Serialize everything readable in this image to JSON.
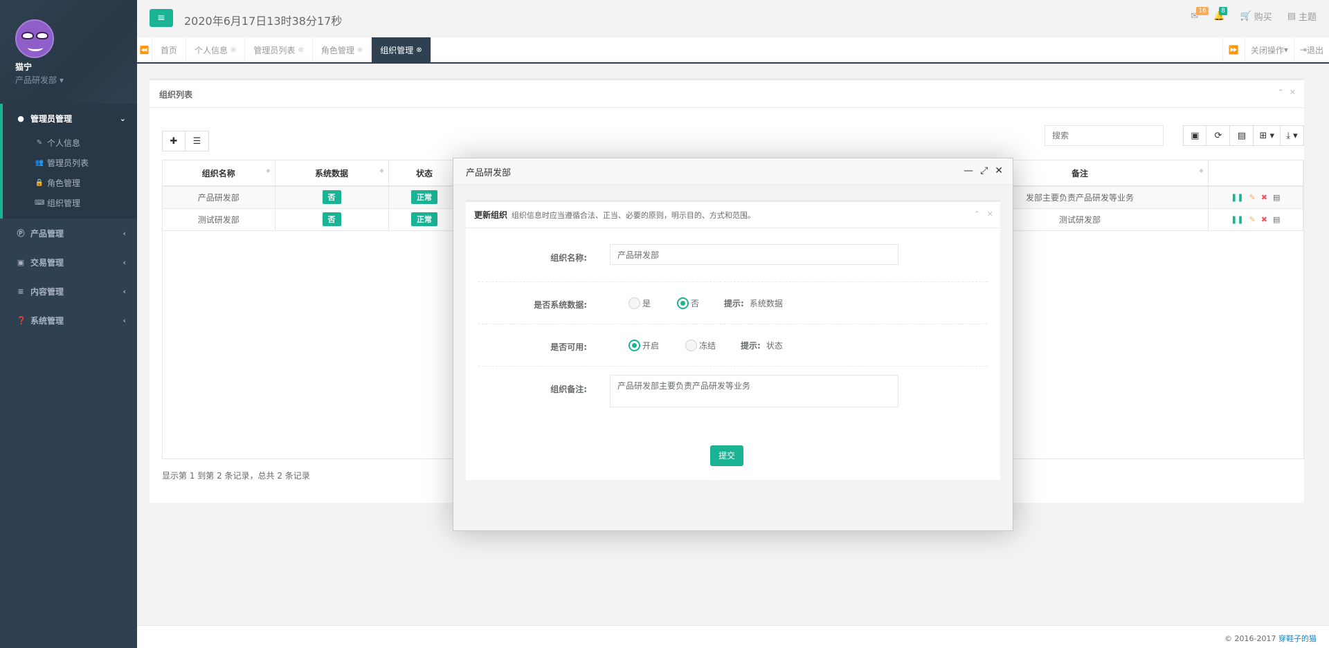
{
  "user": {
    "name": "猫宁",
    "dept": "产品研发部"
  },
  "sidebar": {
    "groups": [
      {
        "label": "管理员管理",
        "icon": "user-icon",
        "items": [
          {
            "label": "个人信息",
            "icon": "user-edit-icon"
          },
          {
            "label": "管理员列表",
            "icon": "users-icon"
          },
          {
            "label": "角色管理",
            "icon": "lock-icon"
          },
          {
            "label": "组织管理",
            "icon": "keyboard-icon"
          }
        ]
      },
      {
        "label": "产品管理",
        "icon": "product-icon"
      },
      {
        "label": "交易管理",
        "icon": "money-icon"
      },
      {
        "label": "内容管理",
        "icon": "list-icon"
      },
      {
        "label": "系统管理",
        "icon": "question-icon"
      }
    ]
  },
  "topbar": {
    "datetime": "2020年6月17日13时38分17秒",
    "mail_count": "16",
    "bell_count": "8",
    "buy_label": "购买",
    "theme_label": "主题"
  },
  "tabs": [
    "首页",
    "个人信息",
    "管理员列表",
    "角色管理",
    "组织管理"
  ],
  "tabs_right": {
    "close_ops": "关闭操作",
    "logout": "退出"
  },
  "panel": {
    "title": "组织列表",
    "search_placeholder": "搜索",
    "columns": {
      "name": "组织名称",
      "system": "系统数据",
      "status": "状态",
      "remark": "备注"
    },
    "rows": [
      {
        "name": "产品研发部",
        "system": "否",
        "status": "正常",
        "remark": "发部主要负责产品研发等业务"
      },
      {
        "name": "测试研发部",
        "system": "否",
        "status": "正常",
        "remark": "测试研发部"
      }
    ],
    "pagination": "显示第 1 到第 2 条记录，总共 2 条记录"
  },
  "footer": {
    "copyright": "© 2016-2017 ",
    "link": "穿鞋子的猫"
  },
  "modal": {
    "title": "产品研发部",
    "box_title": "更新组织",
    "box_desc": "组织信息时应当遵循合法、正当、必要的原则，明示目的、方式和范围。",
    "form": {
      "name_label": "组织名称:",
      "name_value": "产品研发部",
      "system_label": "是否系统数据:",
      "system_yes": "是",
      "system_no": "否",
      "system_hint_label": "提示:",
      "system_hint": "系统数据",
      "enabled_label": "是否可用:",
      "enabled_on": "开启",
      "enabled_off": "冻结",
      "enabled_hint_label": "提示:",
      "enabled_hint": "状态",
      "remark_label": "组织备注:",
      "remark_value": "产品研发部主要负责产品研发等业务",
      "submit": "提交"
    }
  },
  "colors": {
    "accent": "#1ab394",
    "sidebar": "#2f4050",
    "warning": "#f8ac59",
    "danger": "#ed5565"
  }
}
